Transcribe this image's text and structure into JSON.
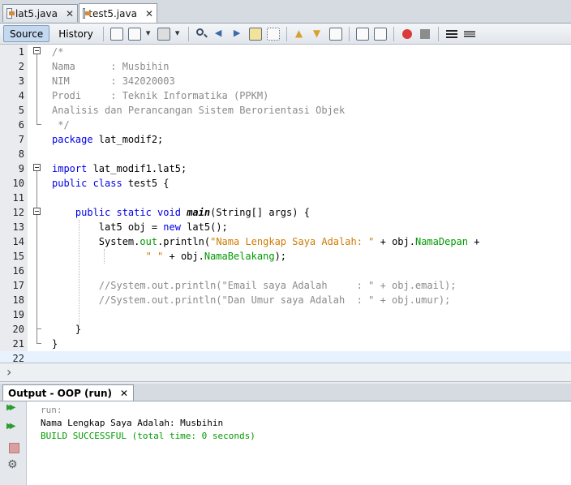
{
  "tabs": [
    {
      "label": "lat5.java",
      "close": "✕",
      "active": false
    },
    {
      "label": "test5.java",
      "close": "✕",
      "active": true
    }
  ],
  "toolbar": {
    "source_label": "Source",
    "history_label": "History"
  },
  "editor": {
    "lines": [
      {
        "num": "1",
        "html": "<span class=\"c-comment\">/*</span>"
      },
      {
        "num": "2",
        "html": "<span class=\"c-comment\">Nama      : Musbihin</span>"
      },
      {
        "num": "3",
        "html": "<span class=\"c-comment\">NIM       : 342020003</span>"
      },
      {
        "num": "4",
        "html": "<span class=\"c-comment\">Prodi     : Teknik Informatika (PPKM)</span>"
      },
      {
        "num": "5",
        "html": "<span class=\"c-comment\">Analisis dan Perancangan Sistem Berorientasi Objek</span>"
      },
      {
        "num": "6",
        "html": "<span class=\"c-comment\"> */</span>"
      },
      {
        "num": "7",
        "html": "<span class=\"c-kw\">package</span> lat_modif2;"
      },
      {
        "num": "8",
        "html": ""
      },
      {
        "num": "9",
        "html": "<span class=\"c-kw\">import</span> lat_modif1.lat5;"
      },
      {
        "num": "10",
        "html": "<span class=\"c-kw\">public class</span> test5 {"
      },
      {
        "num": "11",
        "html": ""
      },
      {
        "num": "12",
        "html": "    <span class=\"c-kw\">public static void</span> <span class=\"c-method\">main</span>(String[] args) {"
      },
      {
        "num": "13",
        "html": "        lat5 obj = <span class=\"c-kw\">new</span> lat5();"
      },
      {
        "num": "14",
        "html": "        System.<span class=\"c-field\">out</span>.println(<span class=\"c-str\">\"Nama Lengkap Saya Adalah: \"</span> + obj.<span class=\"c-field\">NamaDepan</span> +"
      },
      {
        "num": "15",
        "html": "                <span class=\"c-str\">\" \"</span> + obj.<span class=\"c-field\">NamaBelakang</span>);"
      },
      {
        "num": "16",
        "html": ""
      },
      {
        "num": "17",
        "html": "        <span class=\"c-comment\">//System.out.println(\"Email saya Adalah     : \" + obj.email);</span>"
      },
      {
        "num": "18",
        "html": "        <span class=\"c-comment\">//System.out.println(\"Dan Umur saya Adalah  : \" + obj.umur);</span>"
      },
      {
        "num": "19",
        "html": ""
      },
      {
        "num": "20",
        "html": "    }"
      },
      {
        "num": "21",
        "html": "}"
      },
      {
        "num": "22",
        "html": ""
      }
    ]
  },
  "output": {
    "tab_label": "Output - OOP (run)",
    "tab_close": "✕",
    "lines": [
      {
        "text": "run:",
        "color": "grey"
      },
      {
        "text": "Nama Lengkap Saya Adalah: Musbihin",
        "color": "black"
      },
      {
        "text": "BUILD SUCCESSFUL (total time: 0 seconds)",
        "color": "green"
      }
    ]
  }
}
